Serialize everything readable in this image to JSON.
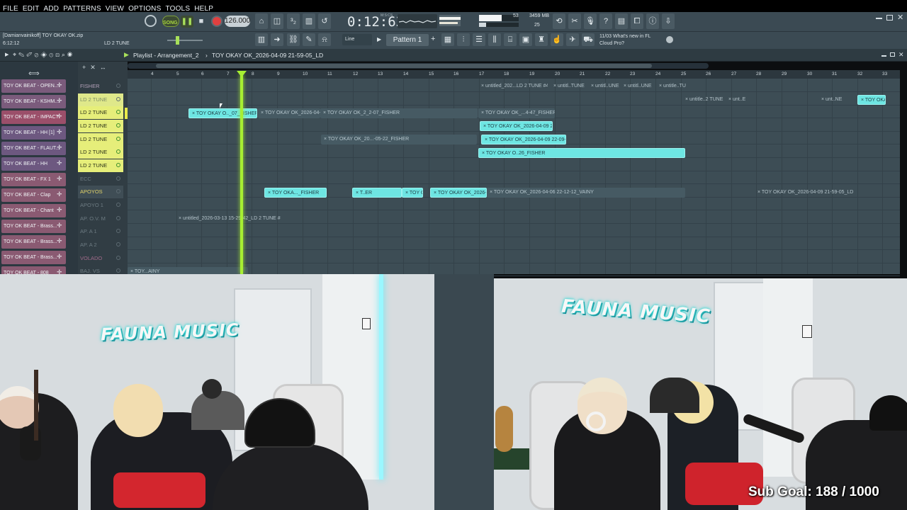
{
  "menu": {
    "items": [
      "FILE",
      "EDIT",
      "ADD",
      "PATTERNS",
      "VIEW",
      "OPTIONS",
      "TOOLS",
      "HELP"
    ]
  },
  "transport": {
    "song_mode": "SONG",
    "tempo": "126.000",
    "time": "0:12:63",
    "time_unit": "M:S:CS",
    "cpu_mem": "3459 MB",
    "cpu_val": "53",
    "cpu_val2": "25"
  },
  "toolbar2": {
    "line_mode": "Line",
    "pattern": "Pattern 1",
    "news_date": "11/03",
    "news_line1": "What's new in FL",
    "news_line2": "Cloud Pro?"
  },
  "project": {
    "file": "[Damianvainikoff] TOY OKAY OK.zip",
    "time": "6:12:12",
    "label": "LD 2 TUNE"
  },
  "playlist": {
    "title": "Playlist - Arrangement_2",
    "separator": "›",
    "subtitle": "TOY OKAY OK_2026-04-09 21-59-05_LD"
  },
  "ruler": [
    "4",
    "5",
    "6",
    "7",
    "8",
    "9",
    "10",
    "11",
    "12",
    "13",
    "14",
    "15",
    "16",
    "17",
    "18",
    "19",
    "20",
    "21",
    "22",
    "23",
    "24",
    "25",
    "26",
    "27",
    "28",
    "29",
    "30",
    "31",
    "32",
    "33"
  ],
  "picker": [
    "TOY OK BEAT - OPEN...",
    "TOY OK BEAT - KSHM...",
    "TOY OK BEAT - IMPACT",
    "TOY OK BEAT - HH [1]",
    "TOY OK BEAT - FLAUT...",
    "TOY OK BEAT - HH",
    "TOY OK BEAT - FX 1",
    "TOY OK BEAT - Clap",
    "TOY OK BEAT - Chant",
    "TOY OK BEAT - Brass...",
    "TOY OK BEAT - Brass...",
    "TOY OK BEAT - Brass...",
    "TOY OK BEAT - 808"
  ],
  "tracks": [
    "FISHER",
    "LD 2 TUNE",
    "LD 2 TUNE",
    "LD 2 TUNE",
    "LD 2 TUNE",
    "LD 2 TUNE",
    "LD 2 TUNE",
    "ECC",
    "APOYOS",
    "APOYO 1",
    "AP. O.V. M",
    "AP. A 1",
    "AP. A 2",
    "VOLADO",
    "BAJ. VS"
  ],
  "clips": [
    {
      "text": "untitled_202...LD 2 TUNE #4",
      "state": "ghost"
    },
    {
      "text": "untitl..TUNE",
      "state": "ghost"
    },
    {
      "text": "untitl..UNE",
      "state": "ghost"
    },
    {
      "text": "untitl..UNE",
      "state": "ghost"
    },
    {
      "text": "untitle..TUNE",
      "state": "ghost"
    },
    {
      "text": "untitle..2 TUNE",
      "state": "ghost"
    },
    {
      "text": "unt..E",
      "state": "ghost"
    },
    {
      "text": "unt..NE",
      "state": "ghost"
    },
    {
      "text": "TOY OKAY OK_..._07_FISHER",
      "state": "on"
    },
    {
      "text": "TOY OKAY O.._07_FISHER",
      "state": "on"
    },
    {
      "text": "TOY OKAY OK_2026-04-09 22-02-07_FISHER",
      "state": "dim"
    },
    {
      "text": "TOY OKAY OK_2_2-07_FISHER",
      "state": "dim"
    },
    {
      "text": "TOY OKAY OK_...4-47_FISHER",
      "state": "dim"
    },
    {
      "text": "TOY OKAY OK_2026-04-09 22-03-06_FISHER",
      "state": "on"
    },
    {
      "text": "TOY OKAY OK_20...-05-22_FISHER",
      "state": "dim"
    },
    {
      "text": "TOY OKAY OK_2026-04-09 22-09-50_FISHER",
      "state": "on"
    },
    {
      "text": "TOY OKAY O..26_FISHER",
      "state": "on"
    },
    {
      "text": "TOY OKA..._FISHER",
      "state": "on"
    },
    {
      "text": "T..ER",
      "state": "on"
    },
    {
      "text": "TOY OKAY O..6_FISHER",
      "state": "on"
    },
    {
      "text": "TOY OKAY OK_2026-04-09 22-10-53_FISHER",
      "state": "on"
    },
    {
      "text": "TOY OKAY OK_2026-04-06 22-12-12_VAINY",
      "state": "dim"
    },
    {
      "text": "TOY OKAY OK_2026-04-09 21-59-05_LD",
      "state": "ghost"
    },
    {
      "text": "untitled_2026-03-13 15-29-42_LD 2 TUNE #",
      "state": "ghost"
    },
    {
      "text": "TOY...AINY",
      "state": "dim"
    }
  ],
  "overlay": {
    "logo": "FAUNA MUSIC",
    "sub_goal": "Sub Goal:  188 / 1000"
  }
}
